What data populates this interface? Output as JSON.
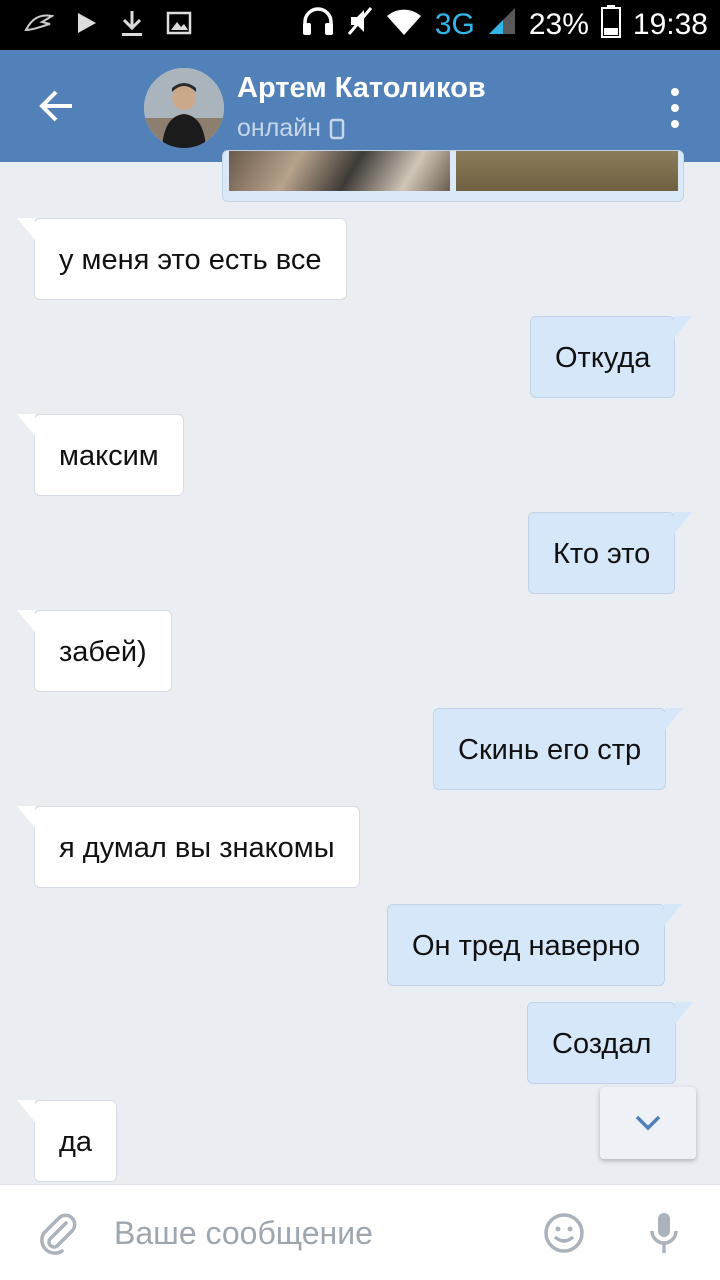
{
  "status_bar": {
    "network": "3G",
    "battery": "23%",
    "time": "19:38",
    "icons": [
      "app-notification-icon",
      "play-icon",
      "download-icon",
      "image-icon",
      "headphones-icon",
      "mute-icon",
      "wifi-icon",
      "signal-icon",
      "battery-icon"
    ]
  },
  "header": {
    "contact_name": "Артем Католиков",
    "status": "онлайн",
    "accent_color": "#5181b8"
  },
  "messages": [
    {
      "dir": "in",
      "text": "у меня это есть все"
    },
    {
      "dir": "out",
      "text": "Откуда"
    },
    {
      "dir": "in",
      "text": "максим"
    },
    {
      "dir": "out",
      "text": "Кто это"
    },
    {
      "dir": "in",
      "text": "забей)"
    },
    {
      "dir": "out",
      "text": "Скинь его стр"
    },
    {
      "dir": "in",
      "text": "я думал вы знакомы"
    },
    {
      "dir": "out",
      "text": "Он тред наверно"
    },
    {
      "dir": "out",
      "text": "Создал"
    },
    {
      "dir": "in",
      "text": "да"
    }
  ],
  "composer": {
    "placeholder": "Ваше сообщение"
  }
}
